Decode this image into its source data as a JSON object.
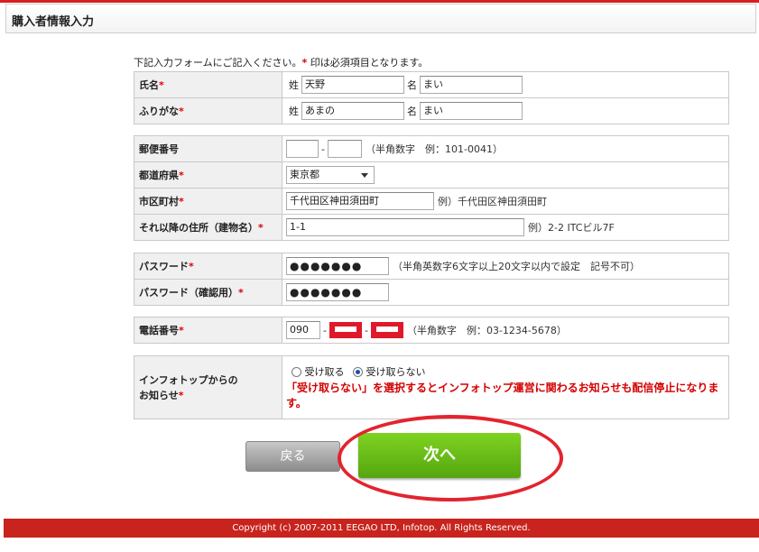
{
  "header": {
    "title": "購入者情報入力"
  },
  "intro": {
    "before": "下記入力フォームにご記入ください。",
    "mark": "*",
    "after": " 印は必須項目となります。"
  },
  "required_mark": "*",
  "name": {
    "label": "氏名",
    "sei_label": "姓",
    "sei_value": "天野",
    "mei_label": "名",
    "mei_value": "まい"
  },
  "kana": {
    "label": "ふりがな",
    "sei_label": "姓",
    "sei_value": "あまの",
    "mei_label": "名",
    "mei_value": "まい"
  },
  "postal": {
    "label": "郵便番号",
    "sep": "-",
    "hint": "（半角数字　例：101-0041）"
  },
  "prefecture": {
    "label": "都道府県",
    "selected": "東京都"
  },
  "city": {
    "label": "市区町村",
    "value": "千代田区神田須田町",
    "hint": "例）千代田区神田須田町"
  },
  "address": {
    "label": "それ以降の住所（建物名）",
    "value": "1-1",
    "hint": "例）2-2 ITCビル7F"
  },
  "password": {
    "label": "パスワード",
    "value": "●●●●●●●",
    "hint": "（半角英数字6文字以上20文字以内で設定　記号不可）"
  },
  "password_confirm": {
    "label": "パスワード（確認用）",
    "value": "●●●●●●●"
  },
  "phone": {
    "label": "電話番号",
    "part1": "090",
    "sep": "-",
    "hint": "（半角数字　例：03-1234-5678）"
  },
  "newsletter": {
    "label_line1": "インフォトップからの",
    "label_line2": "お知らせ",
    "opt_receive": "受け取る",
    "opt_decline": "受け取らない",
    "selected": "受け取らない",
    "warning": "「受け取らない」を選択するとインフォトップ運営に関わるお知らせも配信停止になります。"
  },
  "buttons": {
    "back": "戻る",
    "next": "次へ"
  },
  "footer": {
    "copyright": "Copyright (c) 2007-2011 EEGAO LTD, Infotop. All Rights Reserved."
  },
  "colors": {
    "accent_red": "#d62020",
    "next_green": "#6cc11a",
    "warning_red": "#d40000",
    "annotation_red": "#e3242e"
  }
}
